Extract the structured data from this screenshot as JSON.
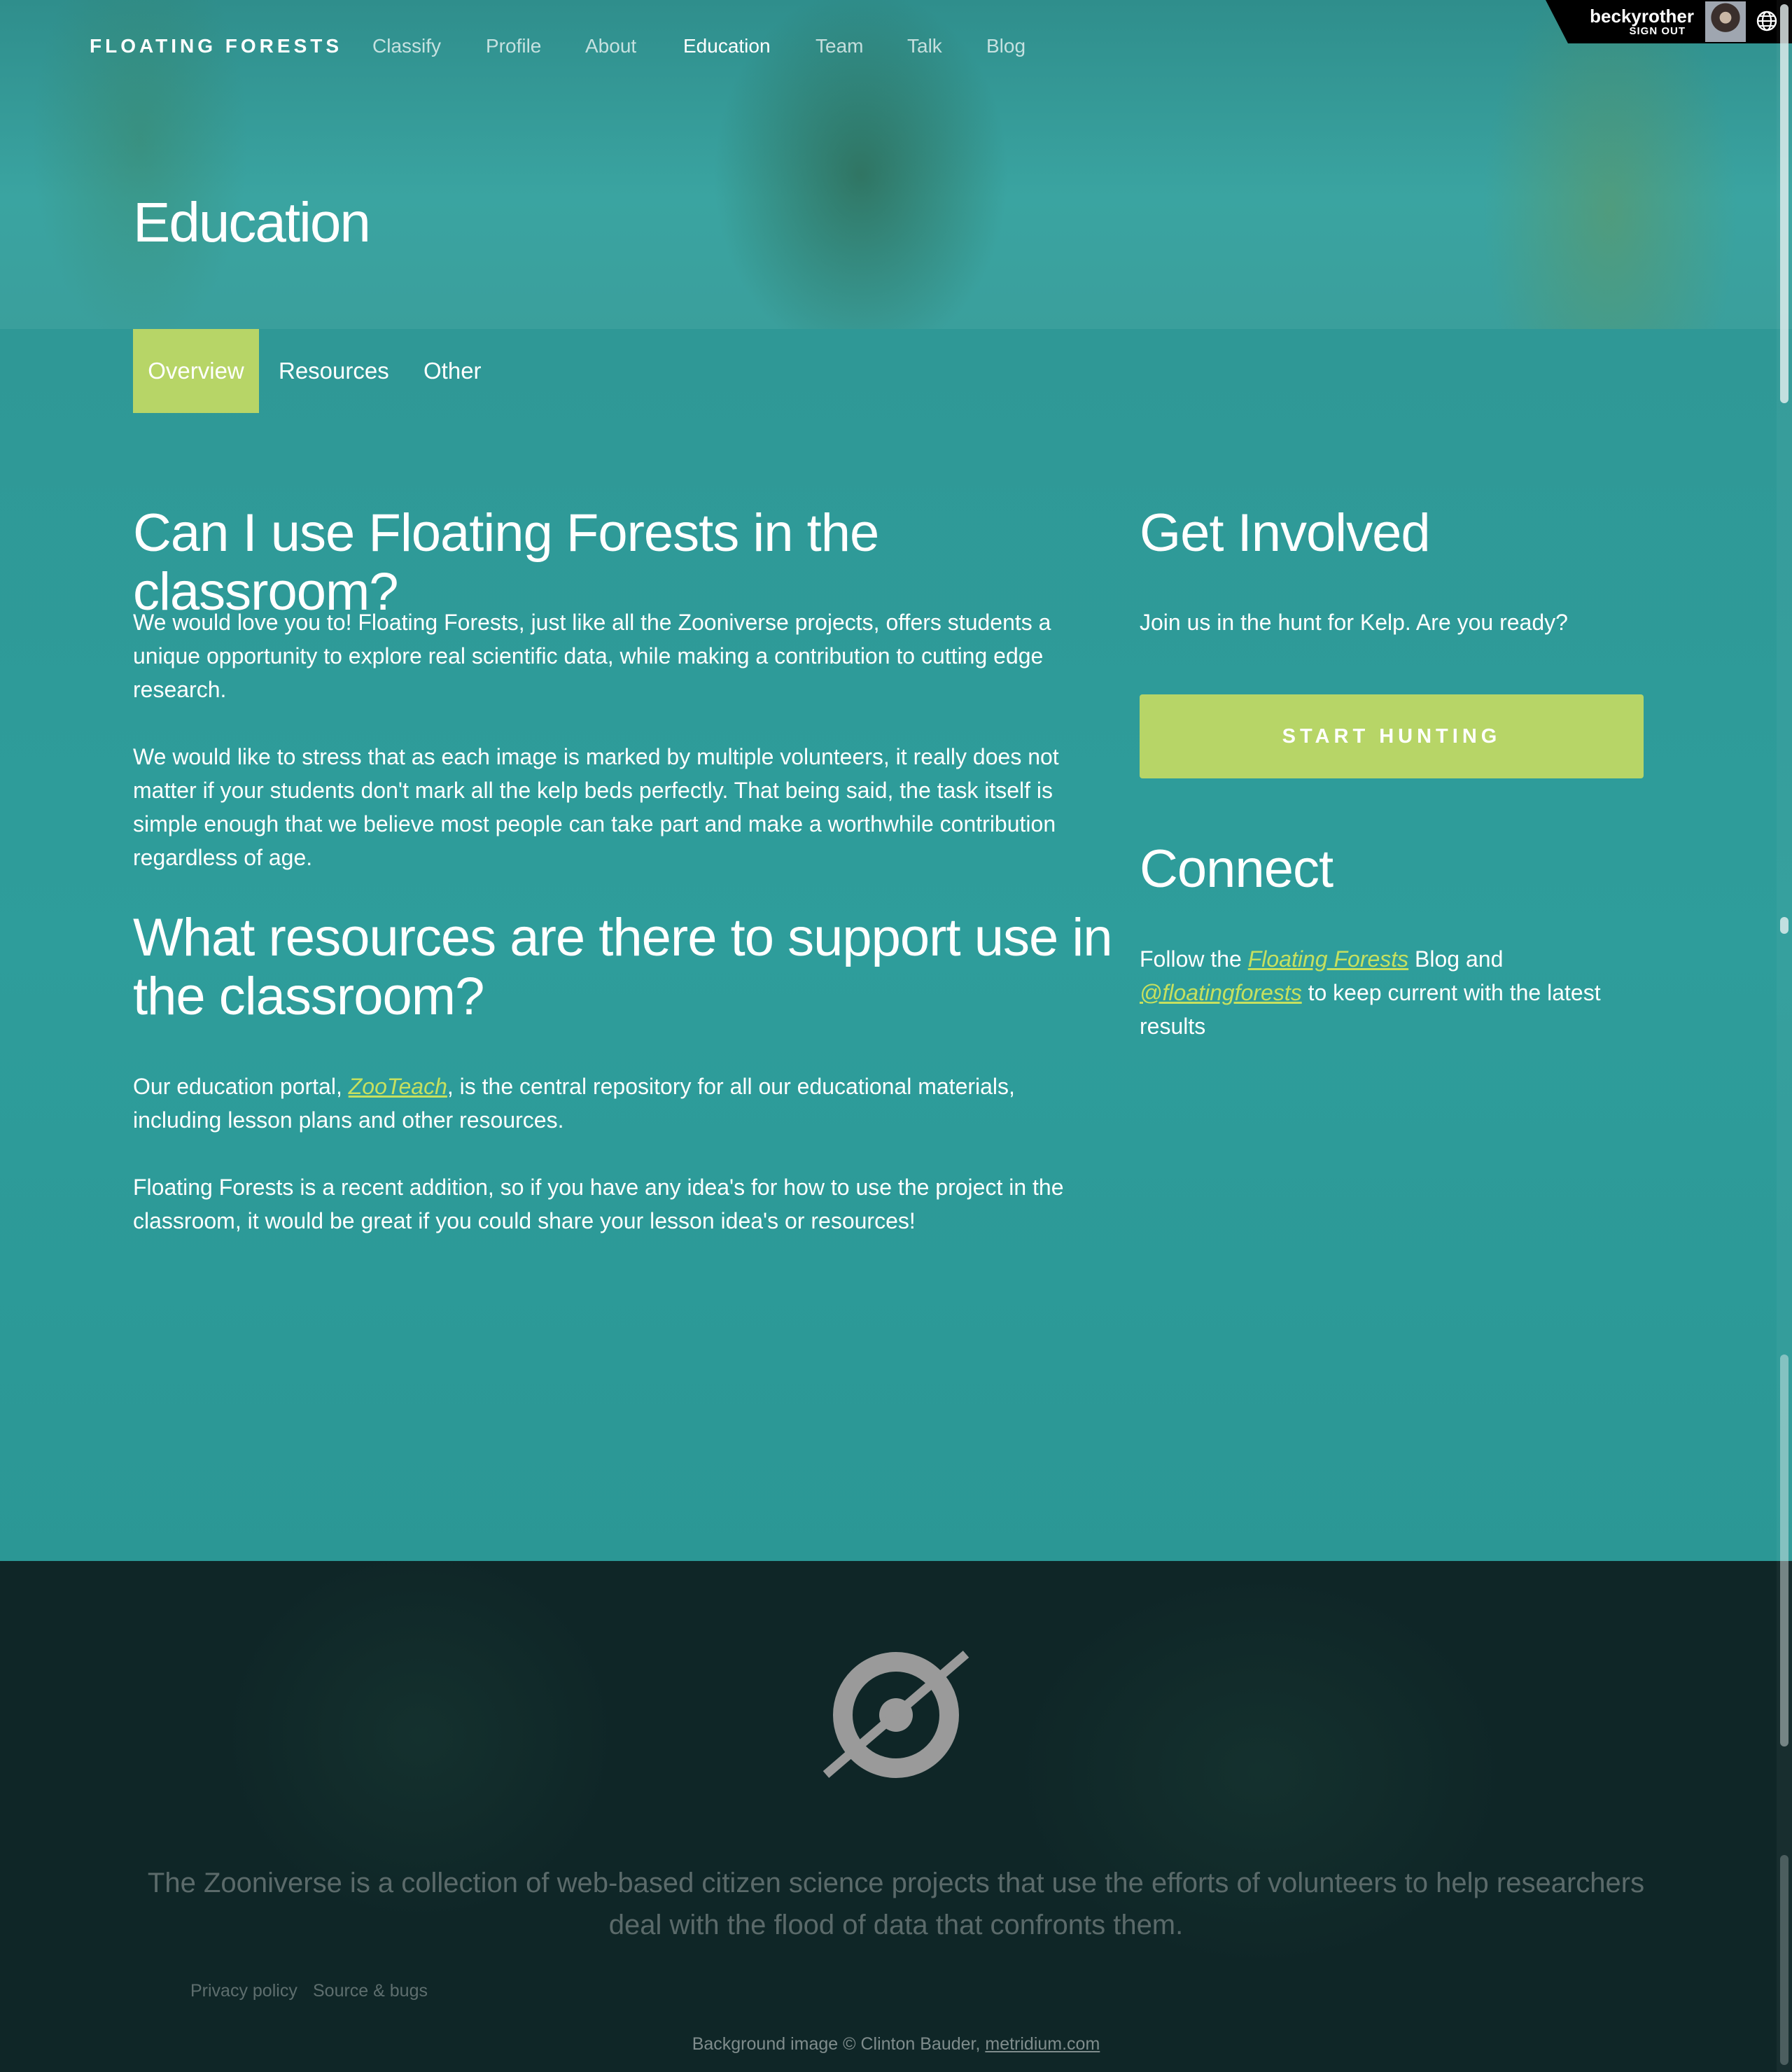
{
  "nav": {
    "brand": "FLOATING FORESTS",
    "links": [
      "Classify",
      "Profile",
      "About",
      "Education",
      "Team",
      "Talk",
      "Blog"
    ],
    "active": "Education"
  },
  "user": {
    "name": "beckyrother",
    "sign_out": "SIGN OUT",
    "avatar_icon": "user-avatar",
    "language_icon": "globe-icon"
  },
  "page": {
    "title": "Education"
  },
  "tabs": {
    "items": [
      "Overview",
      "Resources",
      "Other"
    ],
    "active": "Overview"
  },
  "main": {
    "section1": {
      "heading": "Can I use Floating Forests in the classroom?",
      "p1": "We would love you to! Floating Forests, just like all the Zooniverse projects, offers students a unique opportunity to explore real scientific data, while making a contribution to cutting edge research.",
      "p2": "We would like to stress that as each image is marked by multiple volunteers, it really does not matter if your students don't mark all the kelp beds perfectly. That being said, the task itself is simple enough that we believe most people can take part and make a worthwhile contribution regardless of age."
    },
    "section2": {
      "heading_line1": "What resources are there to support use in",
      "heading_line2": "the classroom?",
      "p1_before": "Our education portal, ",
      "p1_link": "ZooTeach",
      "p1_after": ", is the central repository for all our educational materials, including lesson plans and other resources.",
      "p2": "Floating Forests is a recent addition, so if you have any idea's for how to use the project in the classroom, it would be great if you could share your lesson idea's or resources!"
    }
  },
  "sidebar": {
    "get_involved": {
      "heading": "Get Involved",
      "text": "Join us in the hunt for Kelp. Are you ready?",
      "button": "START HUNTING"
    },
    "connect": {
      "heading": "Connect",
      "before": "Follow the ",
      "blog_link": "Floating Forests",
      "middle": " Blog and",
      "twitter_link": "@floatingforests",
      "after": " to keep current with the latest results"
    }
  },
  "footer": {
    "logo_icon": "zooniverse-logo-icon",
    "tagline": "The Zooniverse is a collection of web-based citizen science projects that use the efforts of volunteers to help researchers deal with the flood of data that confronts them.",
    "links": [
      "Privacy policy",
      "Source & bugs"
    ],
    "credit_text": "Background image © Clinton Bauder, ",
    "credit_link": "metridium.com"
  },
  "colors": {
    "accent": "#b7d567",
    "link": "#c6e05f",
    "teal": "#2e9a98",
    "footer": "#0f2627"
  }
}
